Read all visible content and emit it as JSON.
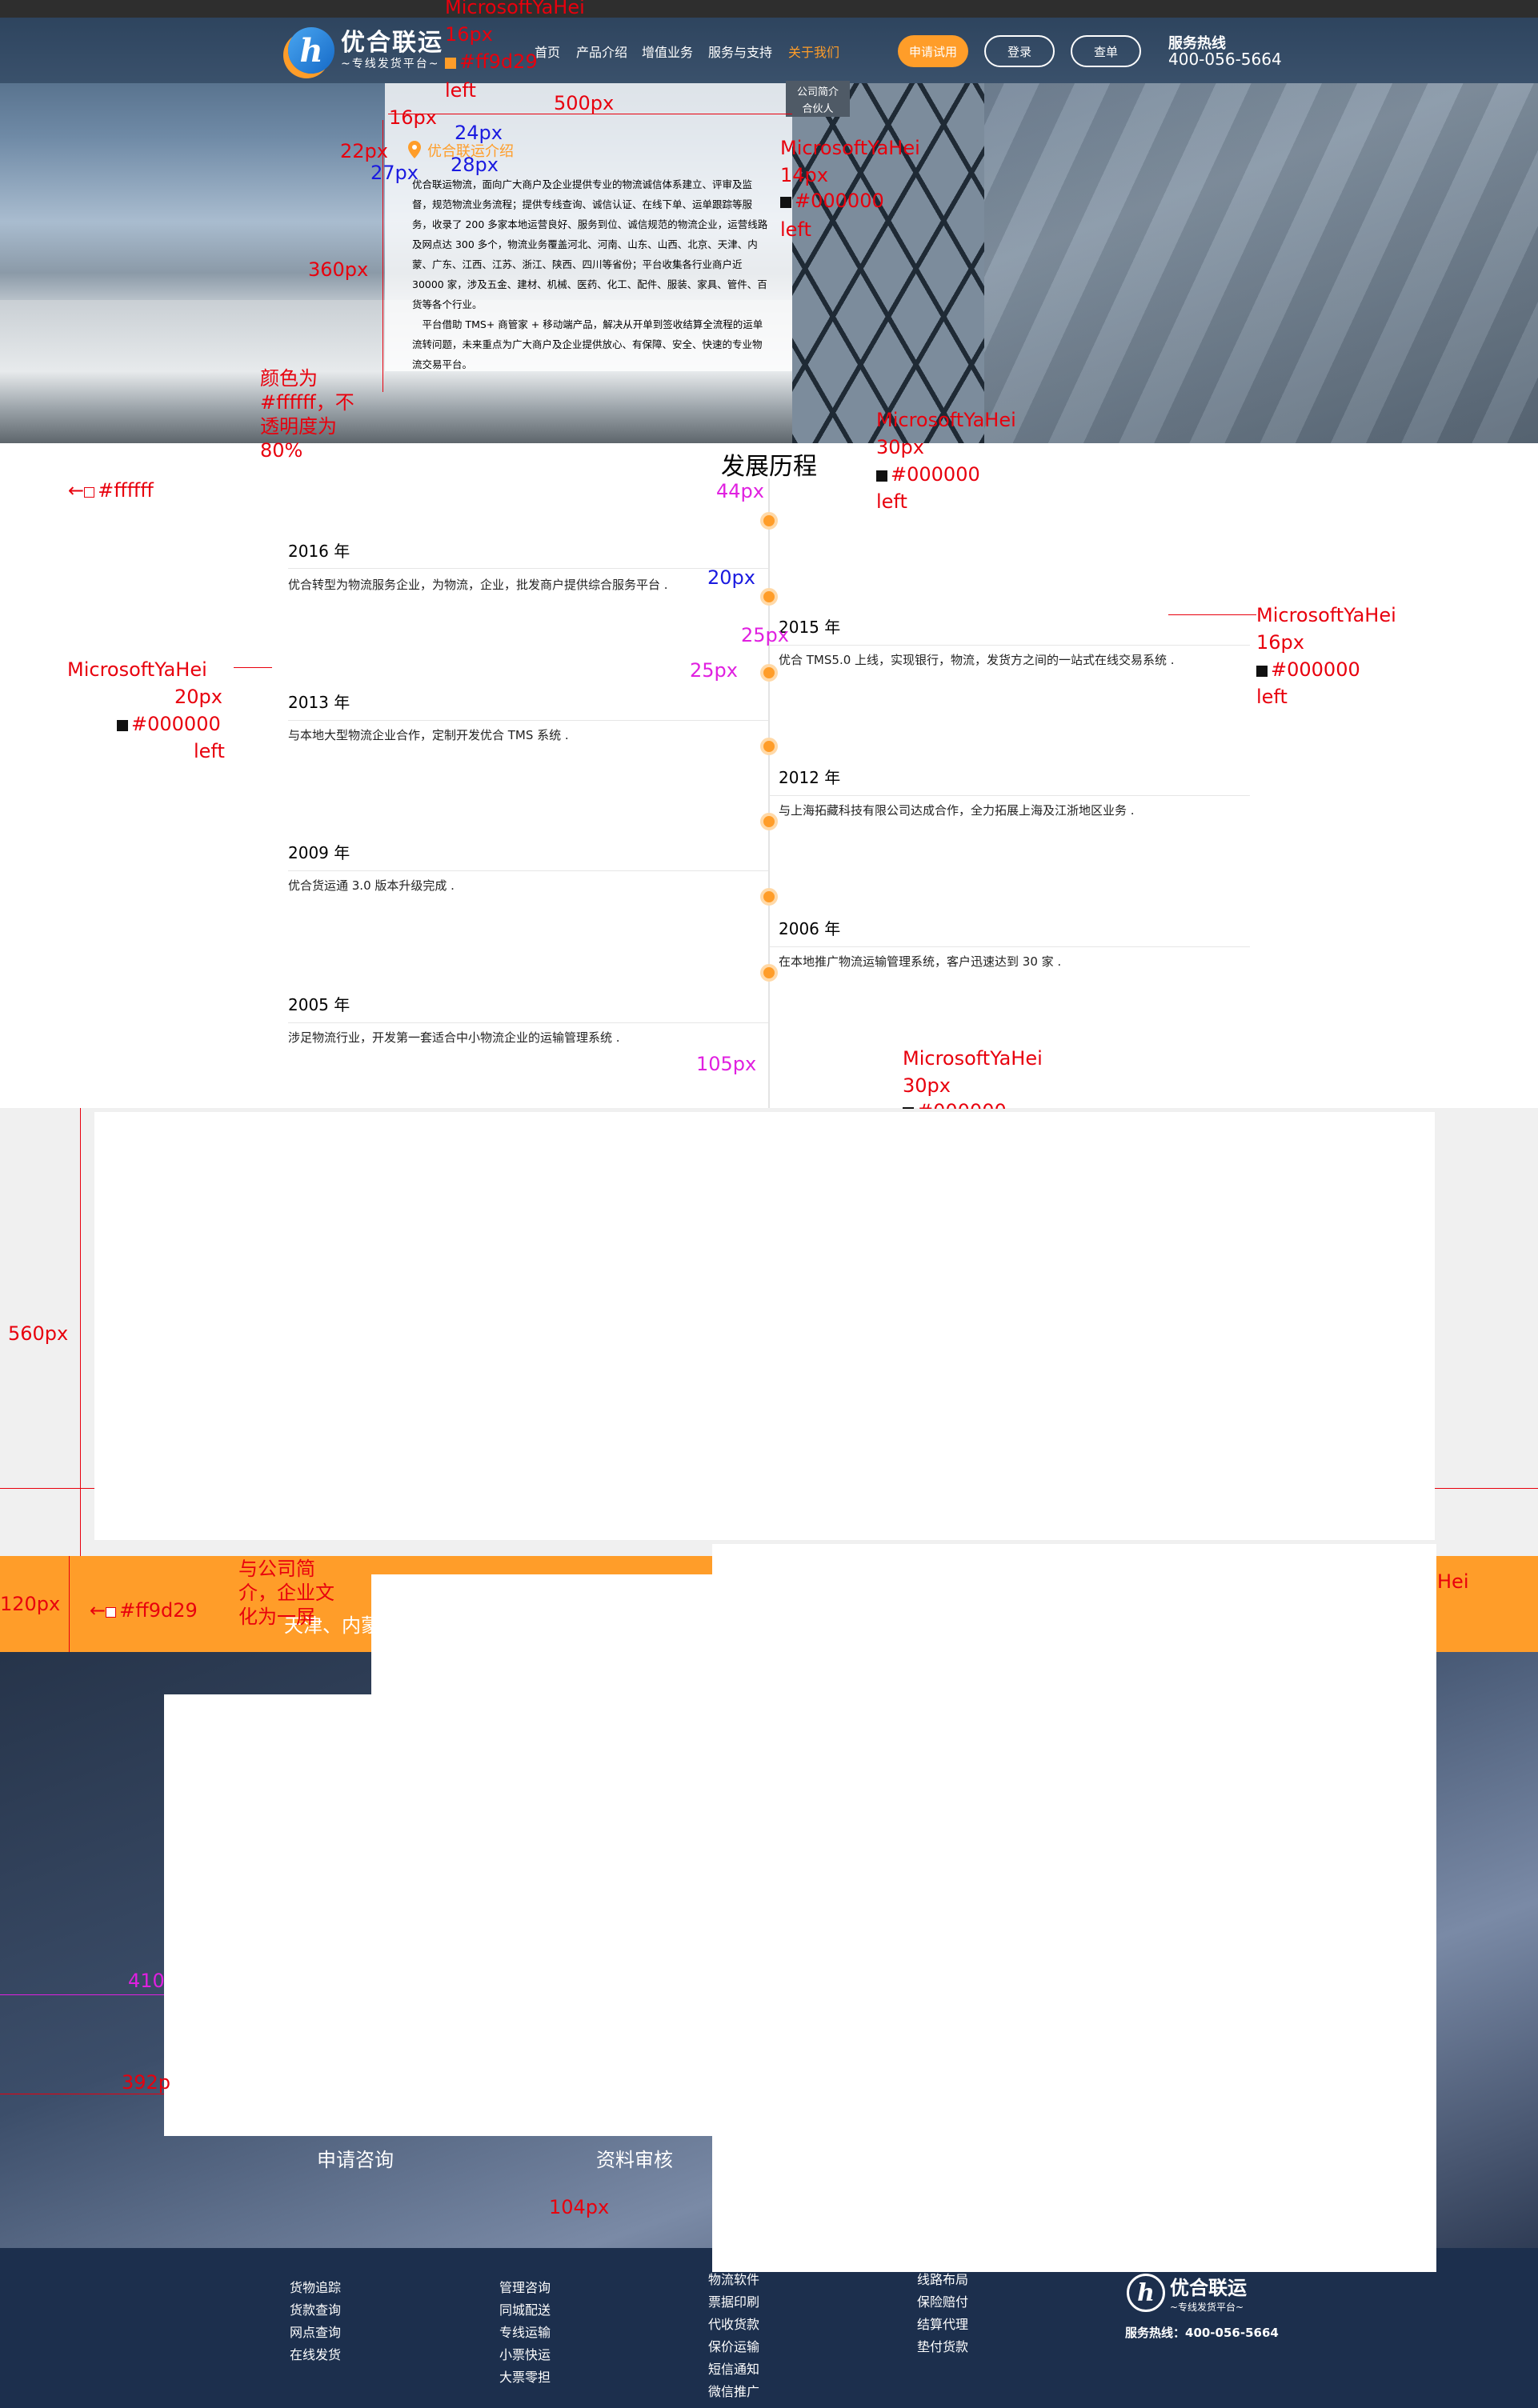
{
  "header": {
    "logo_title": "优合联运",
    "logo_sub": "~专线发货平台~",
    "logo_mark": "h",
    "nav": [
      "首页",
      "产品介绍",
      "增值业务",
      "服务与支持",
      "关于我们"
    ],
    "trial_btn": "申请试用",
    "login_btn": "登录",
    "query_btn": "查单",
    "hotline_label": "服务热线",
    "hotline_number": "400-056-5664"
  },
  "intro": {
    "side_tabs": [
      "公司简介",
      "合伙人"
    ],
    "title": "优合联运介绍",
    "para1": "优合联运物流，面向广大商户及企业提供专业的物流诚信体系建立、评审及监督，规范物流业务流程；提供专线查询、诚信认证、在线下单、运单跟踪等服务，收录了 200 多家本地运营良好、服务到位、诚信规范的物流企业，运营线路及网点达 300 多个，物流业务覆盖河北、河南、山东、山西、北京、天津、内蒙、广东、江西、江苏、浙江、陕西、四川等省份；平台收集各行业商户近 30000 家，涉及五金、建材、机械、医药、化工、配件、服装、家具、管件、百货等各个行业。",
    "para2": "平台借助 TMS+ 商管家 + 移动端产品，解决从开单到签收结算全流程的运单流转问题，未来重点为广大商户及企业提供放心、有保障、安全、快速的专业物流交易平台。"
  },
  "timeline": {
    "title": "发展历程",
    "events": [
      {
        "year": "2016 年",
        "text": "优合转型为物流服务企业，为物流，企业，批发商户提供综合服务平台 ."
      },
      {
        "year": "2015 年",
        "text": "优合 TMS5.0 上线，实现银行，物流，发货方之间的一站式在线交易系统 ."
      },
      {
        "year": "2013 年",
        "text": "与本地大型物流企业合作，定制开发优合 TMS 系统 ."
      },
      {
        "year": "2012 年",
        "text": "与上海拓藏科技有限公司达成合作，全力拓展上海及江浙地区业务 ."
      },
      {
        "year": "2009 年",
        "text": "优合货运通 3.0 版本升级完成 ."
      },
      {
        "year": "2006 年",
        "text": "在本地推广物流运输管理系统，客户迅速达到 30 家 ."
      },
      {
        "year": "2005 年",
        "text": "涉足物流行业，开发第一套适合中小物流企业的运输管理系统 ."
      }
    ]
  },
  "orange_band": {
    "text": "天津、内蒙"
  },
  "steps": [
    "申请咨询",
    "资料审核"
  ],
  "footer": {
    "col1": [
      "货物追踪",
      "货款查询",
      "网点查询",
      "在线发货"
    ],
    "col2": [
      "管理咨询",
      "同城配送",
      "专线运输",
      "小票快运",
      "大票零担"
    ],
    "col3": [
      "物流软件",
      "票据印刷",
      "代收货款",
      "保价运输",
      "短信通知",
      "微信推广"
    ],
    "col4": [
      "线路布局",
      "保险赔付",
      "结算代理",
      "垫付货款"
    ],
    "logo_title": "优合联运",
    "logo_sub": "~专线发货平台~",
    "hotline": "服务热线：400-056-5664"
  },
  "annotations": {
    "font": "MicrosoftYaHei",
    "s16": "16px",
    "s14": "14px",
    "s20": "20px",
    "s30": "30px",
    "c_orange": "#ff9d29",
    "c_black": "#000000",
    "c_white": "#ffffff",
    "left": "left",
    "d500": "500px",
    "d16": "16px",
    "d22": "22px",
    "d24": "24px",
    "d27": "27px",
    "d28": "28px",
    "d360": "360px",
    "d44": "44px",
    "d20": "20px",
    "d25a": "25px",
    "d25b": "25px",
    "d105": "105px",
    "d560": "560px",
    "d120": "120px",
    "d410": "410",
    "d392": "392p",
    "d104": "104px",
    "note_white": "颜色为\n#ffffff，不\n透明度为\n80%",
    "note_orange": "与公司简\n介，企业文\n化为一屏",
    "right_frag": "Hei"
  }
}
